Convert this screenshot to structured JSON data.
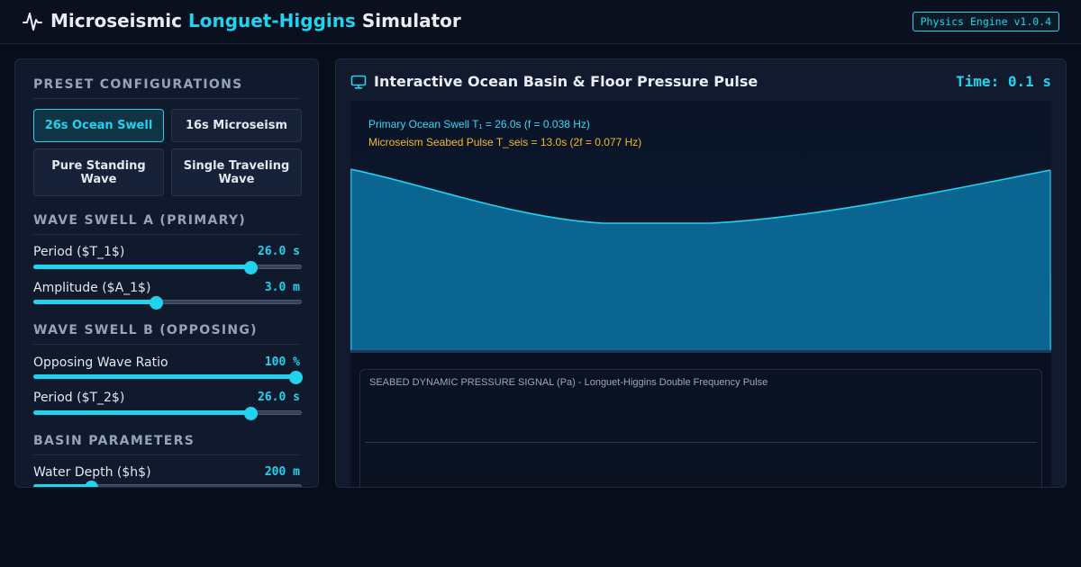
{
  "header": {
    "title_prefix": "Microseismic",
    "title_accent": "Longuet-Higgins",
    "title_suffix": "Simulator",
    "version_badge": "Physics Engine v1.0.4"
  },
  "sidebar": {
    "presets_title": "PRESET CONFIGURATIONS",
    "presets": [
      {
        "label": "26s Ocean Swell",
        "active": true
      },
      {
        "label": "16s Microseism",
        "active": false
      },
      {
        "label": "Pure Standing Wave",
        "active": false
      },
      {
        "label": "Single Traveling Wave",
        "active": false
      }
    ],
    "swell_a_title": "WAVE SWELL A (PRIMARY)",
    "swell_b_title": "WAVE SWELL B (OPPOSING)",
    "basin_title": "BASIN PARAMETERS",
    "controls": {
      "period_a": {
        "label": "Period ($T_1$)",
        "value": "26.0 s",
        "fraction": 0.825
      },
      "amplitude_a": {
        "label": "Amplitude ($A_1$)",
        "value": "3.0 m",
        "fraction": 0.455
      },
      "opposing_ratio": {
        "label": "Opposing Wave Ratio",
        "value": "100 %",
        "fraction": 1.0
      },
      "period_b": {
        "label": "Period ($T_2$)",
        "value": "26.0 s",
        "fraction": 0.825
      },
      "water_depth": {
        "label": "Water Depth ($h$)",
        "value": "200 m",
        "fraction": 0.2
      }
    }
  },
  "main": {
    "title": "Interactive Ocean Basin & Floor Pressure Pulse",
    "time_label": "Time: 0.1 s",
    "legend_primary": "Primary Ocean Swell T₁ = 26.0s (f = 0.038 Hz)",
    "legend_seismic": "Microseism Seabed Pulse T_seis = 13.0s (2f = 0.077 Hz)",
    "pressure_label": "SEABED DYNAMIC PRESSURE SIGNAL (Pa) - Longuet-Higgins Double Frequency Pulse"
  },
  "colors": {
    "accent": "#22d3ee",
    "seismic": "#f5b82e",
    "water": "#0a6590",
    "background": "#080d19"
  },
  "icons": {
    "logo": "pulse-icon",
    "panel": "monitor-icon"
  }
}
